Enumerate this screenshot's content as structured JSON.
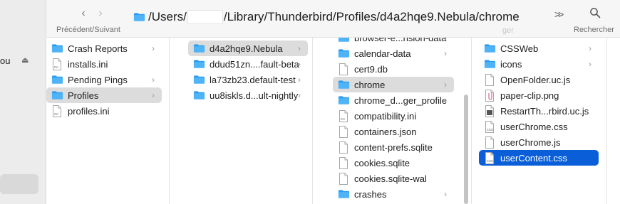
{
  "sidebar": {
    "fragment": "ou"
  },
  "toolbar": {
    "nav_label": "Précédent/Suivant",
    "path_prefix": "/Users/",
    "path_suffix": "/Library/Thunderbird/Profiles/d4a2hqe9.Nebula/chrome",
    "search_label": "Rechercher",
    "hidden_label": "ger"
  },
  "columns": [
    {
      "items": [
        {
          "name": "Crash Reports",
          "type": "folder",
          "chevron": true,
          "state": ""
        },
        {
          "name": "installs.ini",
          "type": "ini",
          "chevron": false,
          "state": ""
        },
        {
          "name": "Pending Pings",
          "type": "folder",
          "chevron": true,
          "state": ""
        },
        {
          "name": "Profiles",
          "type": "folder",
          "chevron": true,
          "state": "hl"
        },
        {
          "name": "profiles.ini",
          "type": "ini",
          "chevron": false,
          "state": ""
        }
      ]
    },
    {
      "items": [
        {
          "name": "d4a2hqe9.Nebula",
          "type": "folder",
          "chevron": true,
          "state": "hl"
        },
        {
          "name": "ddud51zn....fault-beta",
          "type": "folder",
          "chevron": true,
          "state": ""
        },
        {
          "name": "la73zb23.default-test",
          "type": "folder",
          "chevron": true,
          "state": ""
        },
        {
          "name": "uu8iskls.d...ult-nightly",
          "type": "folder",
          "chevron": true,
          "state": ""
        }
      ]
    },
    {
      "items": [
        {
          "name": "browser-e...nsion-data",
          "type": "folder",
          "chevron": true,
          "state": ""
        },
        {
          "name": "calendar-data",
          "type": "folder",
          "chevron": true,
          "state": ""
        },
        {
          "name": "cert9.db",
          "type": "doc",
          "chevron": false,
          "state": ""
        },
        {
          "name": "chrome",
          "type": "folder",
          "chevron": true,
          "state": "hl"
        },
        {
          "name": "chrome_d...ger_profile",
          "type": "folder",
          "chevron": true,
          "state": ""
        },
        {
          "name": "compatibility.ini",
          "type": "ini",
          "chevron": false,
          "state": ""
        },
        {
          "name": "containers.json",
          "type": "doc",
          "chevron": false,
          "state": ""
        },
        {
          "name": "content-prefs.sqlite",
          "type": "doc",
          "chevron": false,
          "state": ""
        },
        {
          "name": "cookies.sqlite",
          "type": "doc",
          "chevron": false,
          "state": ""
        },
        {
          "name": "cookies.sqlite-wal",
          "type": "doc",
          "chevron": false,
          "state": ""
        },
        {
          "name": "crashes",
          "type": "folder",
          "chevron": true,
          "state": ""
        }
      ]
    },
    {
      "items": [
        {
          "name": "CSSWeb",
          "type": "folder",
          "chevron": true,
          "state": ""
        },
        {
          "name": "icons",
          "type": "folder",
          "chevron": true,
          "state": ""
        },
        {
          "name": "OpenFolder.uc.js",
          "type": "doc",
          "chevron": false,
          "state": ""
        },
        {
          "name": "paper-clip.png",
          "type": "img",
          "chevron": false,
          "state": ""
        },
        {
          "name": "RestartTh...rbird.uc.js",
          "type": "exec",
          "chevron": false,
          "state": ""
        },
        {
          "name": "userChrome.css",
          "type": "css",
          "chevron": false,
          "state": ""
        },
        {
          "name": "userChrome.js",
          "type": "doc",
          "chevron": false,
          "state": ""
        },
        {
          "name": "userContent.css",
          "type": "css",
          "chevron": false,
          "state": "sel"
        }
      ]
    }
  ]
}
